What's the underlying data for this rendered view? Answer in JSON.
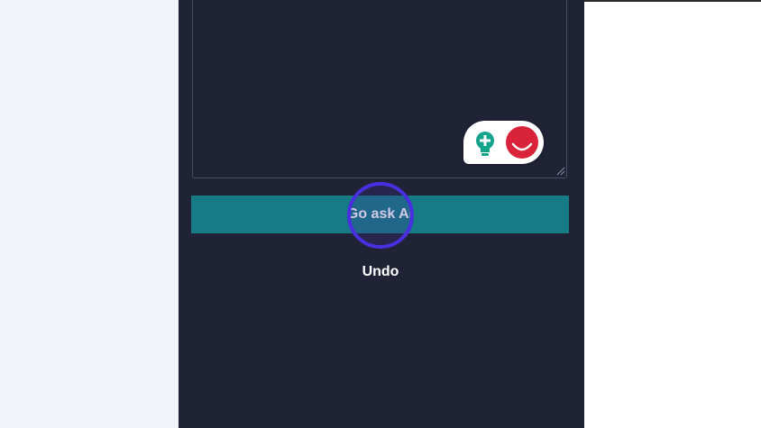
{
  "colors": {
    "panel_bg": "#202236",
    "page_bg": "#f0f3f8",
    "button_bg": "#177b85",
    "button_text": "#ffffff",
    "click_ring": "#4a2fe0",
    "extension_red": "#d8233a",
    "extension_teal": "#14a38b"
  },
  "prompt": {
    "value": ""
  },
  "actions": {
    "ask_label": "Go ask AI",
    "undo_label": "Undo"
  },
  "extension": {
    "icons": [
      "lightbulb-plus-icon",
      "red-smile-icon"
    ]
  }
}
